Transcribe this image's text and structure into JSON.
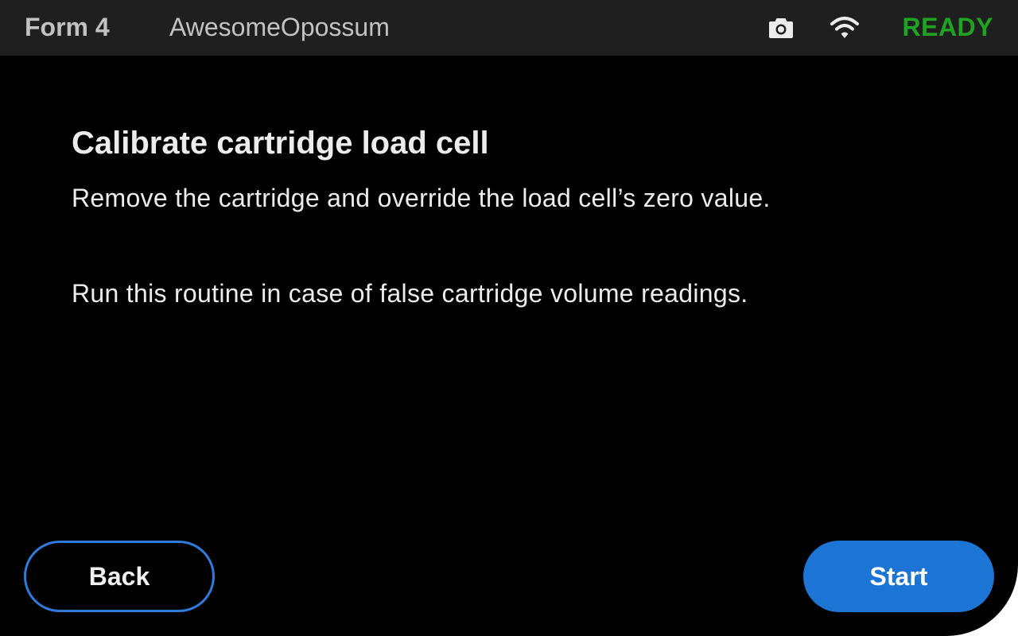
{
  "colors": {
    "ready": "#1fa323",
    "primary": "#1c74d4",
    "text": "#ececec",
    "status_bar": "#1f1f1f",
    "background": "#000000"
  },
  "status_bar": {
    "model": "Form 4",
    "printer_name": "AwesomeOpossum",
    "icons": [
      "camera-icon",
      "wifi-icon"
    ],
    "status": "READY"
  },
  "main": {
    "title": "Calibrate cartridge load cell",
    "description": "Remove the cartridge and override the load cell’s zero value.",
    "note": "Run this routine in case of false cartridge volume readings."
  },
  "actions": {
    "back_label": "Back",
    "start_label": "Start"
  }
}
